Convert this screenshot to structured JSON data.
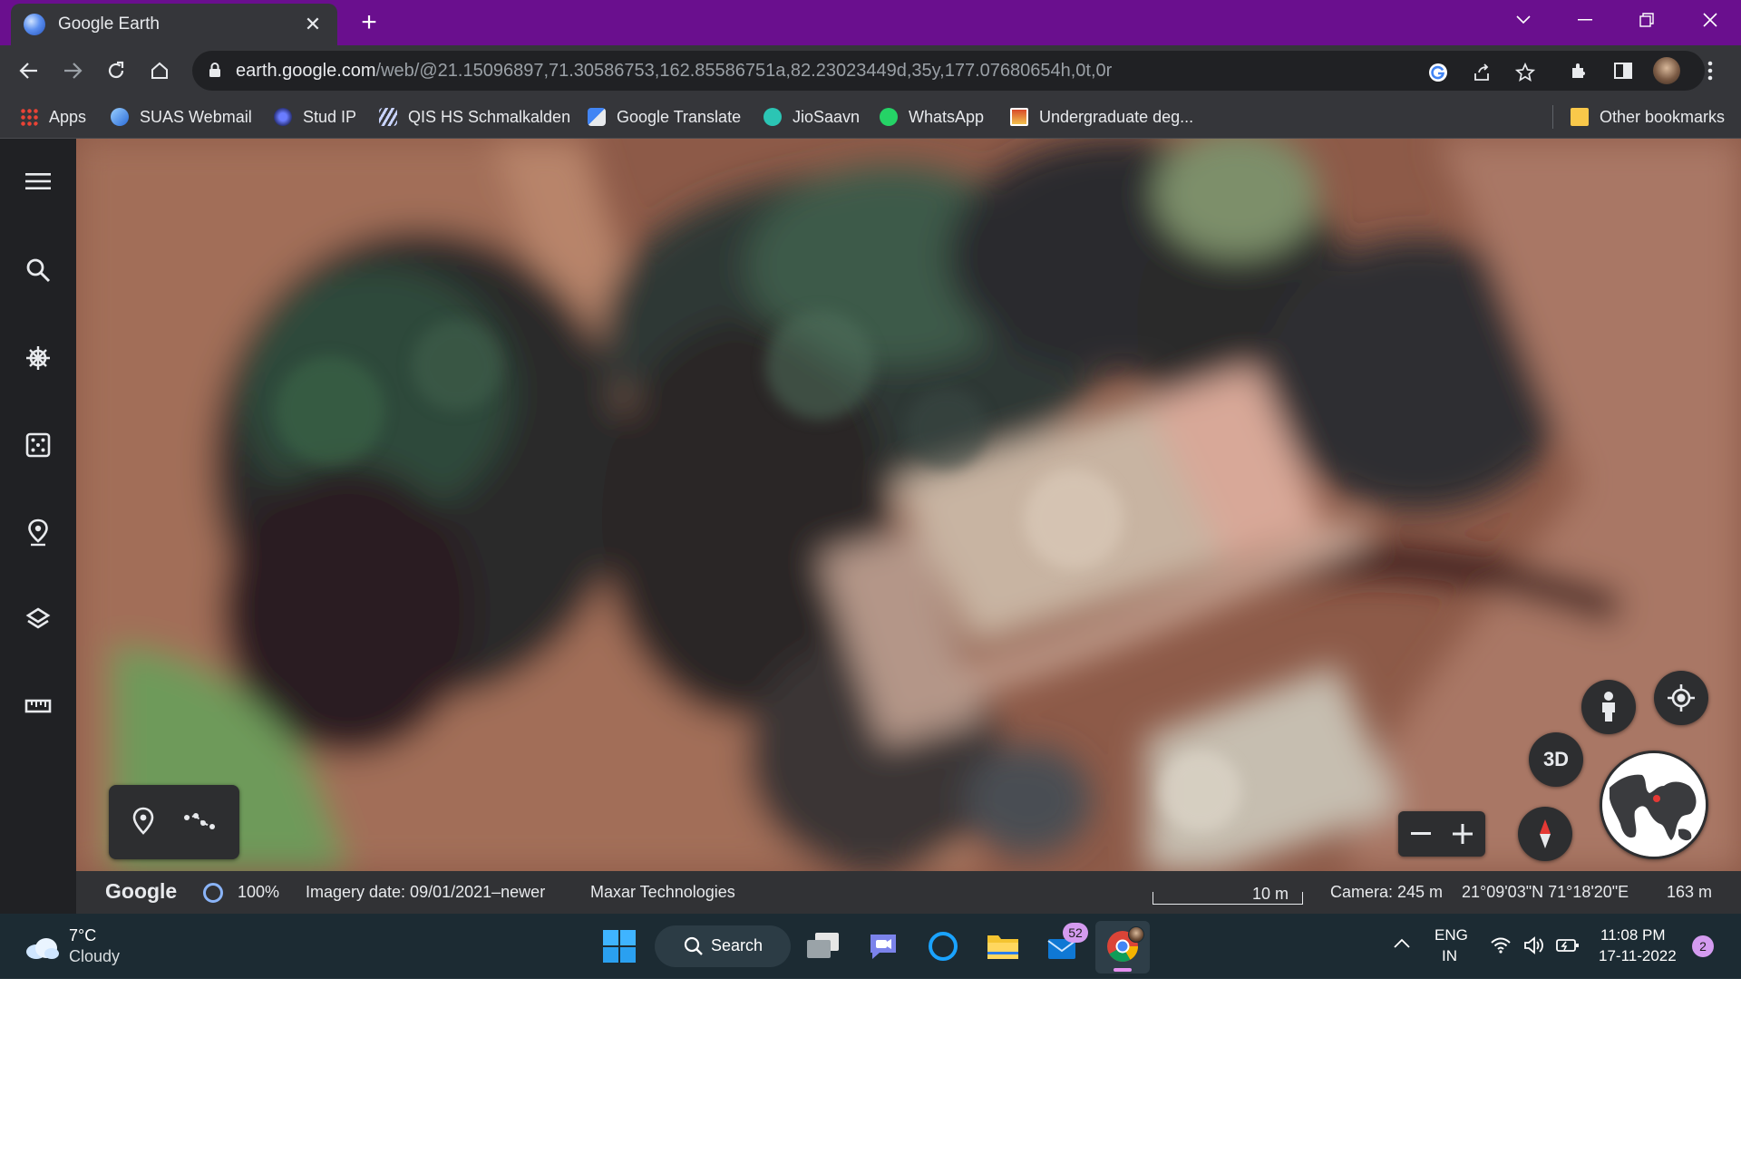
{
  "browser": {
    "tab_title": "Google Earth",
    "url_host": "earth.google.com",
    "url_path": "/web/@21.15096897,71.30586753,162.85586751a,82.23023449d,35y,177.07680654h,0t,0r",
    "accent_color": "#6a0f8e"
  },
  "bookmarks": [
    {
      "label": "Apps",
      "icon": "apps-grid-icon"
    },
    {
      "label": "SUAS Webmail",
      "icon": "webmail-icon"
    },
    {
      "label": "Stud IP",
      "icon": "studip-icon"
    },
    {
      "label": "QIS HS Schmalkalden",
      "icon": "qis-icon"
    },
    {
      "label": "Google Translate",
      "icon": "translate-icon"
    },
    {
      "label": "JioSaavn",
      "icon": "jiosaavn-icon"
    },
    {
      "label": "WhatsApp",
      "icon": "whatsapp-icon"
    },
    {
      "label": "Undergraduate deg...",
      "icon": "university-icon"
    }
  ],
  "other_bookmarks": "Other bookmarks",
  "earth": {
    "sidebar_icons": [
      "menu-icon",
      "search-icon",
      "voyager-icon",
      "feeling-lucky-icon",
      "projects-icon",
      "map-style-icon",
      "measure-icon"
    ],
    "view_3d_label": "3D",
    "status": {
      "logo": "Google",
      "loading_percent": "100%",
      "imagery_date": "Imagery date: 09/01/2021–newer",
      "provider": "Maxar Technologies",
      "scale": "10 m",
      "camera": "Camera: 245 m",
      "coordinates": "21°09'03\"N 71°18'20\"E",
      "elevation": "163 m"
    }
  },
  "taskbar": {
    "weather_temp": "7°C",
    "weather_desc": "Cloudy",
    "search_label": "Search",
    "mail_badge": "52",
    "lang_top": "ENG",
    "lang_bottom": "IN",
    "time": "11:08 PM",
    "date": "17-11-2022",
    "notification_count": "2"
  }
}
